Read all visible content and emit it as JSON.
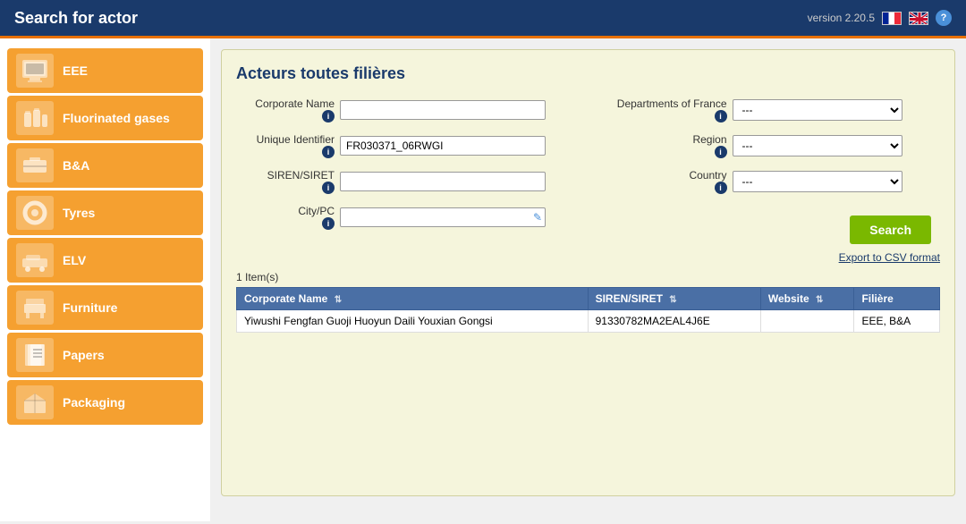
{
  "header": {
    "title": "Search for actor",
    "version": "version 2.20.5"
  },
  "sidebar": {
    "items": [
      {
        "id": "eee",
        "label": "EEE",
        "icon": "🖥"
      },
      {
        "id": "fluorinated-gases",
        "label": "Fluorinated gases",
        "icon": "🔵"
      },
      {
        "id": "bna",
        "label": "B&A",
        "icon": "🔋"
      },
      {
        "id": "tyres",
        "label": "Tyres",
        "icon": "⭕"
      },
      {
        "id": "elv",
        "label": "ELV",
        "icon": "🚗"
      },
      {
        "id": "furniture",
        "label": "Furniture",
        "icon": "🪑"
      },
      {
        "id": "papers",
        "label": "Papers",
        "icon": "📄"
      },
      {
        "id": "packaging",
        "label": "Packaging",
        "icon": "📦"
      }
    ]
  },
  "panel": {
    "title": "Acteurs toutes filières"
  },
  "form": {
    "corporate_name_label": "Corporate Name",
    "corporate_name_value": "",
    "corporate_name_placeholder": "",
    "unique_id_label": "Unique Identifier",
    "unique_id_value": "FR030371_06RWGI",
    "siren_label": "SIREN/SIRET",
    "siren_value": "",
    "city_label": "City/PC",
    "city_value": "",
    "dept_label": "Departments of France",
    "dept_value": "---",
    "region_label": "Region",
    "region_value": "---",
    "country_label": "Country",
    "country_value": "---",
    "info_symbol": "i",
    "dept_options": [
      "---"
    ],
    "region_options": [
      "---"
    ],
    "country_options": [
      "---"
    ]
  },
  "search_button": "Search",
  "export_link": "Export to CSV format",
  "results": {
    "count_label": "1 Item(s)",
    "columns": [
      {
        "id": "corporate-name",
        "label": "Corporate Name"
      },
      {
        "id": "siren-siret",
        "label": "SIREN/SIRET"
      },
      {
        "id": "website",
        "label": "Website"
      },
      {
        "id": "filiere",
        "label": "Filière"
      }
    ],
    "rows": [
      {
        "corporate_name": "Yiwushi Fengfan Guoji Huoyun Daili Youxian Gongsi",
        "siren_siret": "91330782MA2EAL4J6E",
        "website": "",
        "filiere": "EEE, B&A"
      }
    ]
  }
}
